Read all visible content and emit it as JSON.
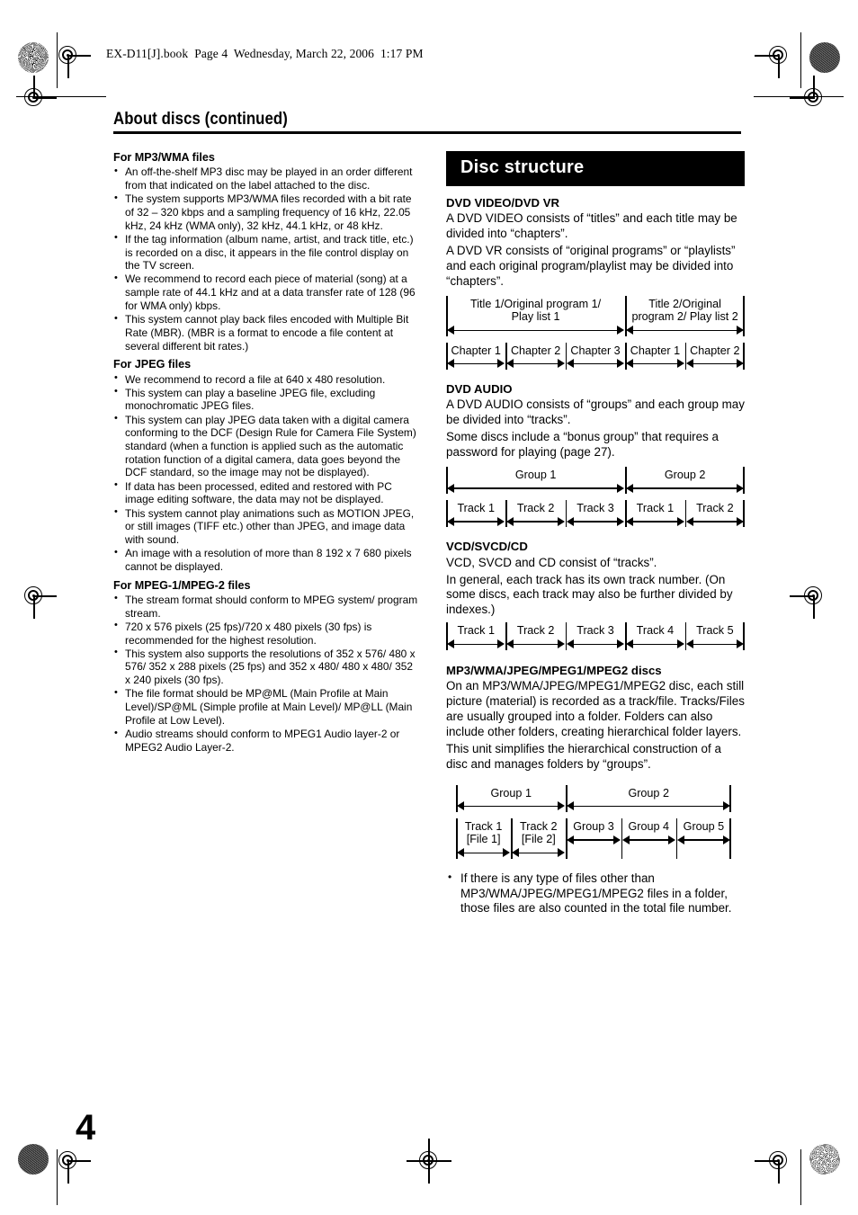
{
  "file_header": "EX-D11[J].book  Page 4  Wednesday, March 22, 2006  1:17 PM",
  "page_title": "About discs (continued)",
  "page_number": "4",
  "left_column": {
    "sections": [
      {
        "heading": "For MP3/WMA files",
        "bullets": [
          "An off-the-shelf MP3 disc may be played in an order different from that indicated on the label attached to the disc.",
          "The system supports MP3/WMA files recorded with a bit rate of 32 – 320 kbps and a sampling frequency of 16 kHz, 22.05 kHz, 24 kHz (WMA only), 32 kHz, 44.1 kHz, or 48 kHz.",
          "If the tag information (album name, artist, and track title, etc.) is recorded on a disc, it appears in the file control display on the TV screen.",
          "We recommend to record each piece of material (song) at a sample rate of 44.1 kHz and at a data transfer rate of 128 (96 for WMA only) kbps.",
          "This system cannot play back files encoded with Multiple Bit Rate (MBR). (MBR is a format to encode a file content at several different bit rates.)"
        ]
      },
      {
        "heading": "For JPEG files",
        "bullets": [
          "We recommend to record a file at 640 x 480 resolution.",
          "This system can play a baseline JPEG file, excluding monochromatic JPEG files.",
          "This system can play JPEG data taken with a digital camera conforming to the DCF (Design Rule for Camera File System) standard (when a function is applied such as the automatic rotation function of a digital camera, data goes beyond the DCF standard, so the image may not be displayed).",
          "If data has been processed, edited and restored with PC image editing software, the data may not be displayed.",
          "This system cannot play animations such as MOTION JPEG, or still images (TIFF etc.) other than JPEG, and image data with sound.",
          "An image with a resolution of more than 8 192 x 7 680 pixels cannot be displayed."
        ]
      },
      {
        "heading": "For MPEG-1/MPEG-2 files",
        "bullets": [
          "The stream format should conform to MPEG system/ program stream.",
          "720 x 576 pixels (25 fps)/720 x 480 pixels (30 fps) is recommended for the highest resolution.",
          "This system also supports the resolutions of 352 x 576/ 480 x 576/ 352 x 288 pixels (25 fps) and 352 x 480/ 480 x 480/ 352 x 240 pixels (30 fps).",
          "The file format should be MP@ML (Main Profile at Main Level)/SP@ML (Simple profile at Main Level)/ MP@LL (Main Profile at Low Level).",
          "Audio streams should conform to MPEG1 Audio layer-2 or MPEG2 Audio Layer-2."
        ]
      }
    ]
  },
  "right_column": {
    "banner_title": "Disc structure",
    "sections": [
      {
        "heading": "DVD VIDEO/DVD VR",
        "paragraphs": [
          "A DVD VIDEO consists of “titles” and each title may be divided into “chapters”.",
          "A DVD VR consists of “original programs” or “playlists” and each original program/playlist may be divided into “chapters”."
        ]
      },
      {
        "heading": "DVD AUDIO",
        "paragraphs": [
          "A DVD AUDIO consists of “groups” and each group may be divided into “tracks”.",
          "Some discs include a “bonus group” that requires a password for playing (page 27)."
        ]
      },
      {
        "heading": "VCD/SVCD/CD",
        "paragraphs": [
          "VCD, SVCD and CD consist of “tracks”.",
          "In general, each track has its own track number. (On some discs, each track may also be further divided by indexes.)"
        ]
      },
      {
        "heading": "MP3/WMA/JPEG/MPEG1/MPEG2 discs",
        "paragraphs": [
          "On an MP3/WMA/JPEG/MPEG1/MPEG2 disc, each still picture (material) is recorded as a track/file. Tracks/Files are usually grouped into a folder. Folders can also include other folders, creating hierarchical folder layers.",
          "This unit simplifies the hierarchical construction of a disc and manages folders by “groups”."
        ]
      }
    ],
    "final_bullets": [
      "If there is any type of files other than MP3/WMA/JPEG/MPEG1/MPEG2 files in a folder, those files are also counted in the total file number."
    ]
  },
  "diagrams": {
    "dvd_video": {
      "rows": [
        {
          "cells": [
            {
              "label": "Title 1/Original program 1/\nPlay list 1",
              "flex": 3
            },
            {
              "label": "Title 2/Original\nprogram 2/ Play list 2",
              "flex": 2
            }
          ]
        },
        {
          "cells": [
            {
              "label": "Chapter 1",
              "flex": 1
            },
            {
              "label": "Chapter 2",
              "flex": 1
            },
            {
              "label": "Chapter 3",
              "flex": 1
            },
            {
              "label": "Chapter 1",
              "flex": 1
            },
            {
              "label": "Chapter 2",
              "flex": 1
            }
          ]
        }
      ]
    },
    "dvd_audio": {
      "rows": [
        {
          "cells": [
            {
              "label": "Group 1",
              "flex": 3
            },
            {
              "label": "Group 2",
              "flex": 2
            }
          ]
        },
        {
          "cells": [
            {
              "label": "Track 1",
              "flex": 1
            },
            {
              "label": "Track 2",
              "flex": 1
            },
            {
              "label": "Track 3",
              "flex": 1
            },
            {
              "label": "Track 1",
              "flex": 1
            },
            {
              "label": "Track 2",
              "flex": 1
            }
          ]
        }
      ]
    },
    "vcd_svcd_cd": {
      "rows": [
        {
          "cells": [
            {
              "label": "Track 1",
              "flex": 1
            },
            {
              "label": "Track 2",
              "flex": 1
            },
            {
              "label": "Track 3",
              "flex": 1
            },
            {
              "label": "Track 4",
              "flex": 1
            },
            {
              "label": "Track 5",
              "flex": 1
            }
          ]
        }
      ]
    },
    "mp3_groups": {
      "rows": [
        {
          "cells": [
            {
              "label": "Group 1",
              "flex": 2
            },
            {
              "label": "Group 2",
              "flex": 3
            }
          ]
        },
        {
          "cells": [
            {
              "label": "Track 1\n[File 1]",
              "flex": 1
            },
            {
              "label": "Track 2\n[File 2]",
              "flex": 1
            },
            {
              "label": "Group 3",
              "flex": 1
            },
            {
              "label": "Group 4",
              "flex": 1
            },
            {
              "label": "Group 5",
              "flex": 1
            }
          ]
        }
      ]
    }
  }
}
